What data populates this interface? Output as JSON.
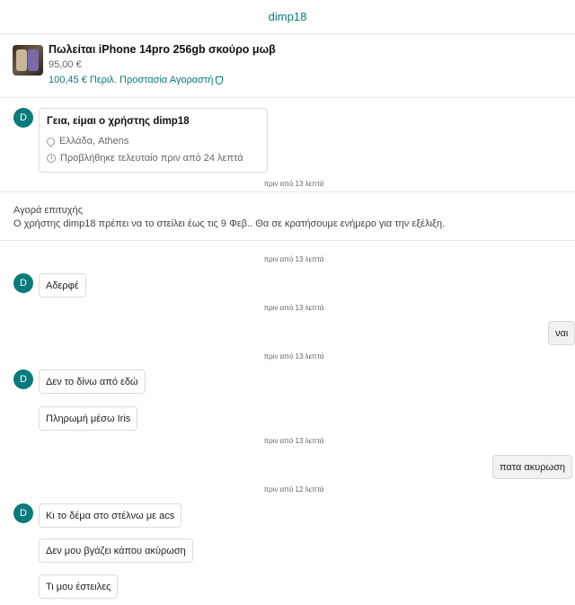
{
  "header": {
    "title": "dimp18"
  },
  "item": {
    "title": "Πωλείται iPhone 14pro 256gb σκούρο μωβ",
    "price": "95,00 €",
    "total": "100,45 € Περιλ. Προστασία Αγοραστή",
    "icon": "shield-icon"
  },
  "profile": {
    "avatar_letter": "D",
    "greeting": "Γεια, είμαι ο χρήστης dimp18",
    "location": "Ελλάδα, Athens",
    "last_seen": "Προβλήθηκε τελευταίο πριν από 24 λεπτά"
  },
  "system": {
    "title": "Αγορά επιτυχής",
    "body": "Ο χρήστης dimp18 πρέπει να το στείλει έως τις 9 Φεβ.. Θα σε κρατήσουμε ενήμερο για την εξέλιξη."
  },
  "timestamps": [
    "πριν από 13 λεπτά",
    "πριν από 13 λεπτά",
    "πριν από 13 λεπτά",
    "πριν από 13 λεπτά",
    "πριν από 13 λεπτά",
    "πριν από 12 λεπτά"
  ],
  "messages": [
    {
      "from": "them",
      "text": "Αδερφέ"
    },
    {
      "from": "me",
      "text": "ναι"
    },
    {
      "from": "them",
      "text": "Δεν το δίνω από εδώ"
    },
    {
      "from": "them",
      "text": "Πληρωμή μέσω Iris"
    },
    {
      "from": "me",
      "text": "πατα ακυρωση"
    },
    {
      "from": "them",
      "text": "Κι το δέμα στο στέλνω με acs"
    },
    {
      "from": "them",
      "text": "Δεν μου βγάζει κάπου ακύρωση"
    },
    {
      "from": "them",
      "text": "Τι μου έστειλες"
    }
  ],
  "colors": {
    "accent": "#0b7a7a",
    "border": "#dcdcdc"
  }
}
